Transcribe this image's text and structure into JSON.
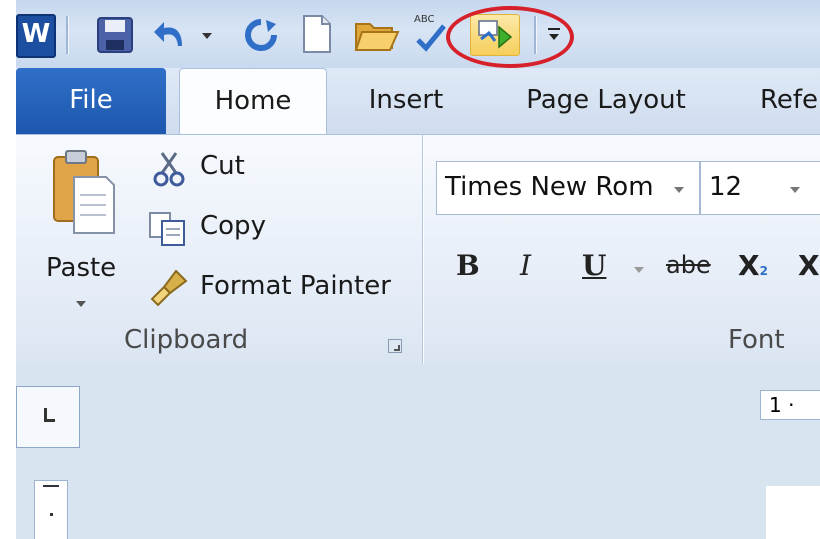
{
  "app": {
    "logo_letter": "W"
  },
  "quick_access": {
    "items": [
      {
        "name": "save-icon"
      },
      {
        "name": "undo-icon"
      },
      {
        "name": "redo-icon"
      },
      {
        "name": "new-document-icon"
      },
      {
        "name": "open-folder-icon"
      },
      {
        "name": "spelling-grammar-icon",
        "badge": "ABC"
      },
      {
        "name": "run-macro-icon",
        "highlighted": true
      },
      {
        "name": "customize-toolbar-icon"
      }
    ],
    "highlight_color": "#d6212b"
  },
  "tabs": [
    {
      "label": "File",
      "active": false
    },
    {
      "label": "Home",
      "active": true
    },
    {
      "label": "Insert",
      "active": false
    },
    {
      "label": "Page Layout",
      "active": false
    },
    {
      "label": "Refe",
      "active": false
    }
  ],
  "clipboard": {
    "paste_label": "Paste",
    "cut_label": "Cut",
    "copy_label": "Copy",
    "format_painter_label": "Format Painter",
    "group_label": "Clipboard"
  },
  "font": {
    "font_name": "Times New Rom",
    "font_size": "12",
    "bold": "B",
    "italic": "I",
    "underline": "U",
    "strikethrough": "abe",
    "subscript": "X",
    "subscript_mark": "2",
    "extra": "X",
    "group_label": "Font"
  },
  "ruler": {
    "h_label": "1 ·"
  },
  "colors": {
    "accent": "#1e57ad",
    "ribbon_bg": "#e7eef8"
  }
}
